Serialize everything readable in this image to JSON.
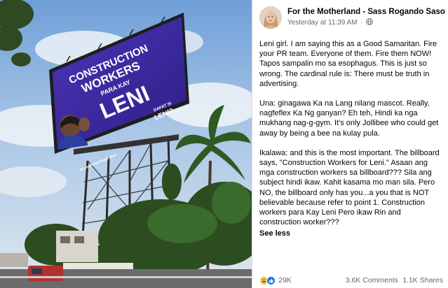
{
  "billboard": {
    "headline_line1": "CONSTRUCTION",
    "headline_line2": "WORKERS",
    "headline_line3": "PARA KAY",
    "headline_name": "LENI",
    "badge_line1": "DAPAT SI",
    "badge_line2": "LENI?",
    "hashtag": "#KulayRosasAngBukas"
  },
  "post": {
    "author": "For the Motherland - Sass Rogando Sasot",
    "timestamp": "Yesterday at 11:39 AM",
    "separator": "·",
    "paragraphs": [
      "Leni girl. I am saying this as a Good Samaritan. Fire your PR team. Everyone of them. Fire them NOW! Tapos sampalin mo sa esophagus. This is just so wrong. The cardinal rule is: There must be truth in advertising.",
      "Una: ginagawa Ka na Lang nilang mascot. Really, nagfeflex Ka Ng ganyan? Eh teh, Hindi ka nga mukhang nag-g-gym. It's only Jollibee who could get away by being a bee na kulay pula.",
      "Ikalawa: and this is the most important. The billboard says, \"Construction Workers for Leni.\" Asaan ang mga construction workers sa billboard??? Sila ang subject hindi ikaw. Kahit kasama mo man sila. Pero NO, the billboard only has you...a you that is NOT believable because refer to point 1. Construction workers para Kay Leni Pero ikaw Rin and construction worker???"
    ],
    "see_less": "See less",
    "reaction_count": "29K",
    "comments": "3.6K Comments",
    "shares": "1.1K Shares"
  },
  "colors": {
    "billboard_purple": "#3b2a9a",
    "link_blue": "#1877f2",
    "meta_gray": "#65676b"
  }
}
